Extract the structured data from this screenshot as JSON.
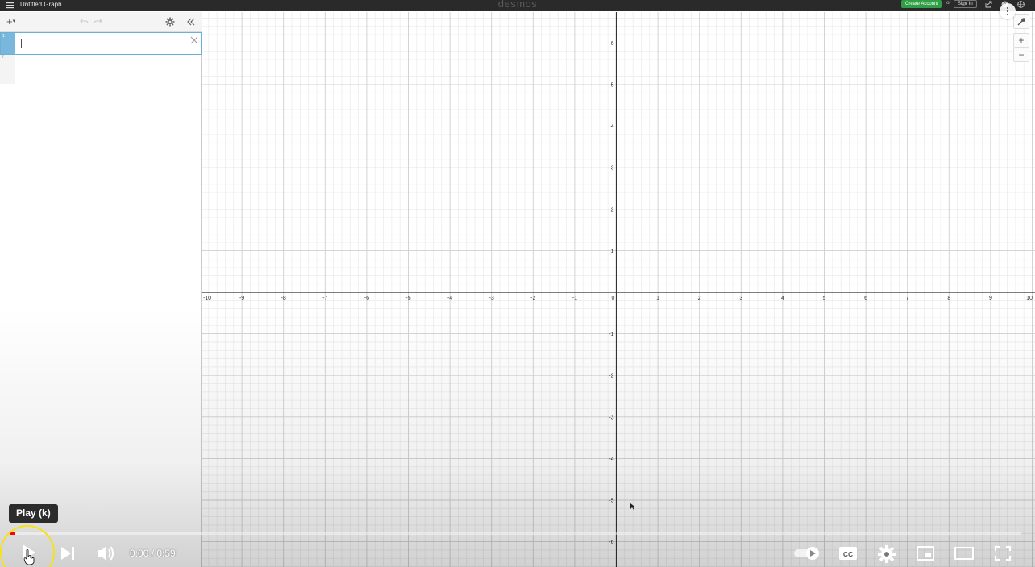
{
  "topbar": {
    "title": "Untitled Graph",
    "brand": "desmos",
    "create_account": "Create Account",
    "or": "or",
    "sign_in": "Sign In"
  },
  "expressions": {
    "row1_num": "1",
    "row2_num": "2",
    "input_value": "|",
    "add_label": "+",
    "add_caret": "▾"
  },
  "graph": {
    "x_ticks": [
      "-10",
      "-9",
      "-8",
      "-7",
      "-6",
      "-5",
      "-4",
      "-3",
      "-2",
      "-1",
      "0",
      "1",
      "2",
      "3",
      "4",
      "5",
      "6",
      "7",
      "8",
      "9",
      "10"
    ],
    "y_ticks_pos": [
      "6",
      "5",
      "4",
      "3",
      "2",
      "1"
    ],
    "y_ticks_neg": [
      "-1",
      "-2",
      "-3",
      "-4",
      "-5",
      "-6"
    ],
    "zoom_in": "+",
    "zoom_out": "−"
  },
  "player": {
    "tooltip": "Play (k)",
    "time_current": "0:00",
    "time_sep": " / ",
    "time_total": "0:59",
    "progress_fraction": 0.005
  },
  "colors": {
    "accent": "#79b7dc",
    "create_green": "#2f9e44",
    "progress_red": "#ff0000",
    "ring_yellow": "#f6e11c"
  }
}
